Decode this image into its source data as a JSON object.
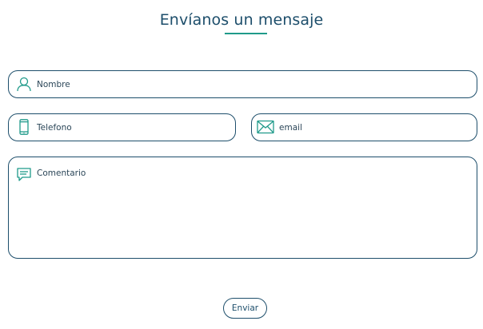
{
  "form": {
    "title": "Envíanos un mensaje",
    "fields": {
      "nombre": {
        "placeholder": "Nombre",
        "icon": "user-icon",
        "value": ""
      },
      "telefono": {
        "placeholder": "Telefono",
        "icon": "phone-icon",
        "value": ""
      },
      "email": {
        "placeholder": "email",
        "icon": "envelope-icon",
        "value": ""
      },
      "comentario": {
        "placeholder": "Comentario",
        "icon": "comment-icon",
        "value": ""
      }
    },
    "submit_label": "Enviar"
  },
  "colors": {
    "primary": "#1d4e6b",
    "accent": "#1f9a8a",
    "background": "#ffffff"
  }
}
